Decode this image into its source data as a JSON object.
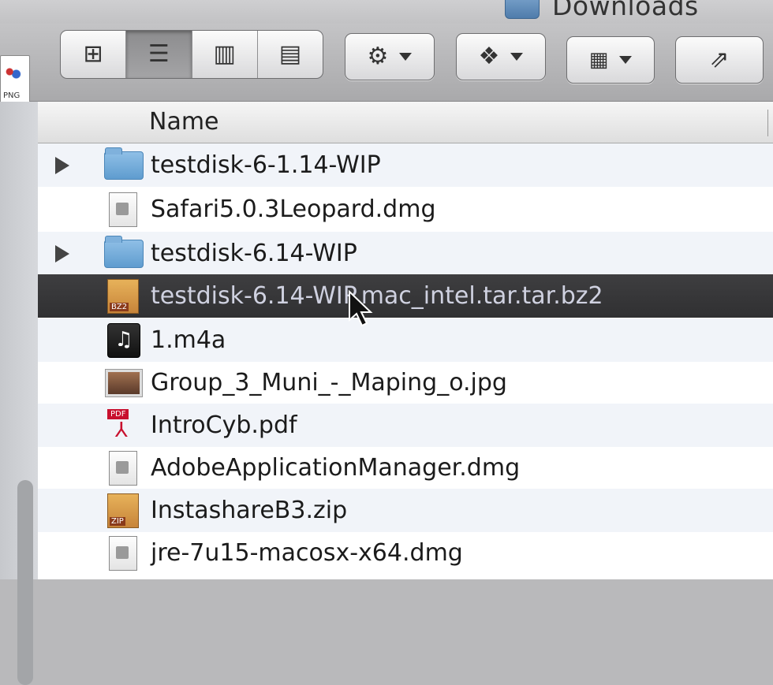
{
  "window": {
    "title": "Downloads"
  },
  "desktop": {
    "file_label": "PNG"
  },
  "toolbar": {
    "view_buttons": [
      {
        "name": "icon-view",
        "icon": "grid-icon",
        "glyph": "⊞",
        "active": false
      },
      {
        "name": "list-view",
        "icon": "list-icon",
        "glyph": "☰",
        "active": true
      },
      {
        "name": "column-view",
        "icon": "columns-icon",
        "glyph": "▥",
        "active": false
      },
      {
        "name": "coverflow-view",
        "icon": "coverflow-icon",
        "glyph": "▤",
        "active": false
      }
    ],
    "action_icon": "gear-icon",
    "dropbox_icon": "dropbox-icon",
    "arrange_icon": "arrange-icon",
    "share_icon": "share-icon"
  },
  "list_header": {
    "name_label": "Name"
  },
  "files": [
    {
      "name": "testdisk-6-1.14-WIP",
      "icon": "folder-icon",
      "kind": "folder",
      "expandable": true,
      "selected": false
    },
    {
      "name": "Safari5.0.3Leopard.dmg",
      "icon": "disk-image-icon",
      "kind": "dmg",
      "expandable": false,
      "selected": false
    },
    {
      "name": "testdisk-6.14-WIP",
      "icon": "folder-icon",
      "kind": "folder",
      "expandable": true,
      "selected": false
    },
    {
      "name": "testdisk-6.14-WIP.mac_intel.tar.tar.bz2",
      "icon": "archive-icon",
      "kind": "bz2",
      "expandable": false,
      "selected": true
    },
    {
      "name": "1.m4a",
      "icon": "music-icon",
      "kind": "m4a",
      "expandable": false,
      "selected": false
    },
    {
      "name": "Group_3_Muni_-_Maping_o.jpg",
      "icon": "image-icon",
      "kind": "jpg",
      "expandable": false,
      "selected": false
    },
    {
      "name": "IntroCyb.pdf",
      "icon": "pdf-icon",
      "kind": "pdf",
      "expandable": false,
      "selected": false
    },
    {
      "name": "AdobeApplicationManager.dmg",
      "icon": "disk-image-icon",
      "kind": "dmg",
      "expandable": false,
      "selected": false
    },
    {
      "name": "InstashareB3.zip",
      "icon": "zip-icon",
      "kind": "zip",
      "expandable": false,
      "selected": false
    },
    {
      "name": "jre-7u15-macosx-x64.dmg",
      "icon": "disk-image-icon",
      "kind": "dmg",
      "expandable": false,
      "selected": false
    }
  ]
}
